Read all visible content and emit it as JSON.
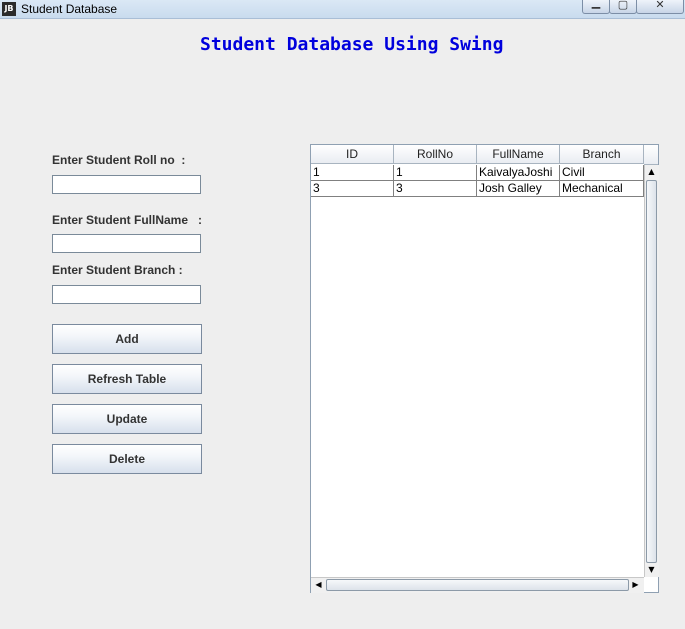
{
  "window": {
    "title": "Student Database",
    "app_icon_text": "JB",
    "minimize_glyph": "▁",
    "maximize_glyph": "▢",
    "close_glyph": "✕"
  },
  "heading": "Student Database Using Swing",
  "form": {
    "roll_label": "Enter Student Roll no  :",
    "fullname_label": "Enter Student FullName   :",
    "branch_label": "Enter Student Branch :",
    "roll_value": "",
    "fullname_value": "",
    "branch_value": ""
  },
  "buttons": {
    "add": "Add",
    "refresh": "Refresh Table",
    "update": "Update",
    "delete": "Delete"
  },
  "table": {
    "columns": [
      "ID",
      "RollNo",
      "FullName",
      "Branch"
    ],
    "rows": [
      [
        "1",
        "1",
        "KaivalyaJoshi",
        "Civil"
      ],
      [
        "3",
        "3",
        "Josh Galley",
        "Mechanical"
      ]
    ]
  },
  "scroll_arrows": {
    "up": "▲",
    "down": "▼",
    "left": "◀",
    "right": "▶"
  },
  "colors": {
    "heading": "#0000dd",
    "window_bg": "#eeeeee"
  }
}
